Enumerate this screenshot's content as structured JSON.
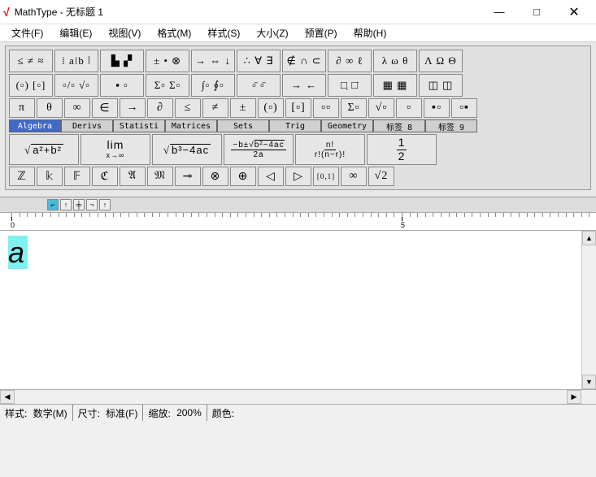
{
  "window": {
    "title": "MathType - 无标题 1",
    "minimize": "—",
    "maximize": "□",
    "close": "✕"
  },
  "menu": [
    "文件(F)",
    "编辑(E)",
    "视图(V)",
    "格式(M)",
    "样式(S)",
    "大小(Z)",
    "预置(P)",
    "帮助(H)"
  ],
  "palette_row1": [
    "≤ ≠ ≈",
    "⁞ a⁞b ⦚",
    "▙ ▞",
    "± • ⊗",
    "→ ⇔ ↓",
    "∴ ∀ ∃",
    "∉ ∩ ⊂",
    "∂ ∞ ℓ",
    "λ ω θ",
    "Λ Ω Θ"
  ],
  "palette_row2": [
    "(▫) [▫]",
    "▫/▫ √▫",
    "▪ ▫",
    "Σ▫ Σ▫",
    "∫▫ ∮▫",
    "▫̄ ▫̄",
    "→ ←",
    "□̣ □̇",
    "▦ ▦",
    "◫ ◫"
  ],
  "palette_row3": [
    "π",
    "θ",
    "∞",
    "∈",
    "→",
    "∂",
    "≤",
    "≠",
    "±",
    "(▫)",
    "[▫]",
    "▫▫",
    "Σ▫",
    "√▫",
    "▫",
    "▪▫",
    "▫▪"
  ],
  "tabs": [
    {
      "label": "Algebra",
      "active": true
    },
    {
      "label": "Derivs",
      "active": false
    },
    {
      "label": "Statisti",
      "active": false
    },
    {
      "label": "Matrices",
      "active": false
    },
    {
      "label": "Sets",
      "active": false
    },
    {
      "label": "Trig",
      "active": false
    },
    {
      "label": "Geometry",
      "active": false
    },
    {
      "label": "标签 8",
      "active": false
    },
    {
      "label": "标签 9",
      "active": false
    }
  ],
  "templates": [
    {
      "html": "√<span style='border-top:1px solid #000;padding:0 2px'>a²+b²</span>"
    },
    {
      "html": "<span class='frac'><span class='num' style='font-size:14px;border:none'>lim</span><span class='den' style='font-size:9px'>x→∞</span></span>"
    },
    {
      "html": "√<span style='border-top:1px solid #000;padding:0 2px'>b³−4ac</span>"
    },
    {
      "html": "<span class='frac'><span class='num'>−b±√<span style='border-top:1px solid #000'>b²−4ac</span></span><span class='den'>2a</span></span>"
    },
    {
      "html": "<span class='frac'><span class='num'>n!</span><span class='den'>r!(n−r)!</span></span>"
    },
    {
      "html": "<span class='frac' style='font-size:14px'><span class='num'>1</span><span class='den'>2</span></span>"
    }
  ],
  "bottom_row": [
    "ℤ",
    "𝕜",
    "𝔽",
    "ℭ",
    "𝔄",
    "𝔐",
    "⊸",
    "⊗",
    "⊕",
    "◁",
    "▷",
    "[0,1]",
    "∞",
    "√2"
  ],
  "ruler": {
    "zero": "0",
    "five": "5"
  },
  "editor": {
    "content": "a"
  },
  "status": {
    "style_label": "样式:",
    "style_value": "数学(M)",
    "size_label": "尺寸:",
    "size_value": "标准(F)",
    "zoom_label": "缩放:",
    "zoom_value": "200%",
    "color_label": "颜色:"
  }
}
